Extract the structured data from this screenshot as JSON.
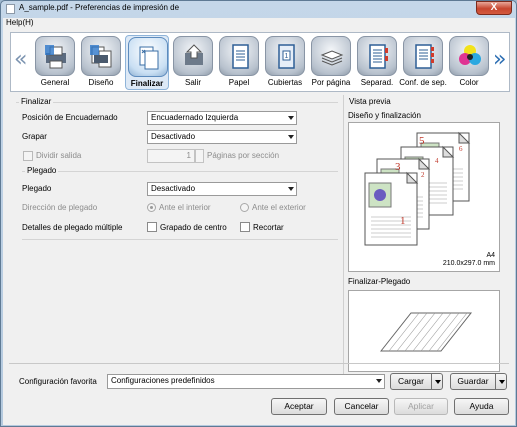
{
  "window": {
    "title": "A_sample.pdf - Preferencias de impresión de",
    "close": "X"
  },
  "menu": {
    "help": "Help(H)"
  },
  "tabs": [
    {
      "label": "General",
      "icon": "printer-icon"
    },
    {
      "label": "Diseño",
      "icon": "layout-icon"
    },
    {
      "label": "Finalizar",
      "icon": "finishing-icon",
      "selected": true
    },
    {
      "label": "Salir",
      "icon": "output-arrow-icon"
    },
    {
      "label": "Papel",
      "icon": "paper-icon"
    },
    {
      "label": "Cubiertas",
      "icon": "cover-icon"
    },
    {
      "label": "Por página",
      "icon": "paper-stack-icon"
    },
    {
      "label": "Separad.",
      "icon": "separator-icon"
    },
    {
      "label": "Conf. de sep.",
      "icon": "separator-settings-icon"
    },
    {
      "label": "Color",
      "icon": "color-balls-icon"
    }
  ],
  "finalizar": {
    "group": "Finalizar",
    "encuadernado_label": "Posición de Encuadernado",
    "encuadernado_value": "Encuadernado Izquierda",
    "grapar_label": "Grapar",
    "grapar_value": "Desactivado",
    "dividir_label": "Dividir salida",
    "dividir_value": "1",
    "paginas_label": "Páginas por sección",
    "plegado_group": "Plegado",
    "plegado_label": "Plegado",
    "plegado_value": "Desactivado",
    "direccion_label": "Dirección de plegado",
    "ante_interior": "Ante el interior",
    "ante_exterior": "Ante el exterior",
    "detalles_label": "Detalles de plegado múltiple",
    "grapado_centro": "Grapado de centro",
    "recortar": "Recortar"
  },
  "preview": {
    "heading": "Vista previa",
    "diseno_label": "Diseño y finalización",
    "page_numbers": [
      "5",
      "3",
      "1",
      "6",
      "4",
      "2"
    ],
    "paper_size": "A4",
    "paper_dims": "210.0x297.0 mm",
    "plegado_label": "Finalizar-Plegado"
  },
  "favorita": {
    "label": "Configuración favorita",
    "value": "Configuraciones predefinidos",
    "cargar": "Cargar",
    "guardar": "Guardar"
  },
  "buttons": {
    "aceptar": "Aceptar",
    "cancelar": "Cancelar",
    "aplicar": "Aplicar",
    "ayuda": "Ayuda"
  }
}
